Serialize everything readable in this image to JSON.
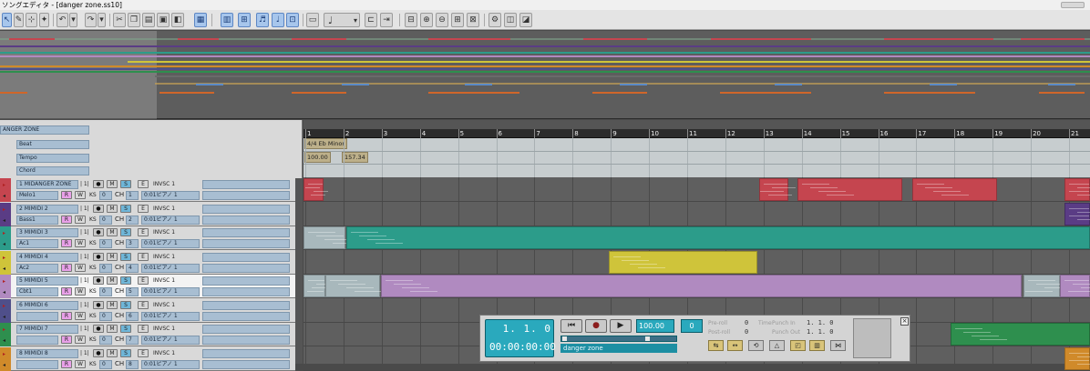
{
  "window": {
    "title": "ソングエディタ - [danger zone.ss10]"
  },
  "toolbar": {
    "note_value": "♩",
    "buttons": [
      "arrow-tool",
      "pencil-tool",
      "select-tool",
      "eraser-tool",
      "undo",
      "redo",
      "cut",
      "copy",
      "paste",
      "delete",
      "quantize",
      "view",
      "grid",
      "snap",
      "auto",
      "metronome",
      "save",
      "note-length",
      "bar",
      "loop"
    ]
  },
  "song": {
    "name": "ANGER ZONE",
    "rows": {
      "beat": "Beat",
      "tempo": "Tempo",
      "chord": "Chord"
    },
    "meter_label": "4/4 Eb Minor",
    "tempo_values": [
      "100.00",
      "157.34"
    ]
  },
  "tracks": [
    {
      "name": "1 MIDANGER ZONE",
      "sub": "Melo1",
      "ch": "1",
      "device": "INVSC 1",
      "patch": "0:01ピアノ 1",
      "color": "#c5454f",
      "label_l": "| 1|",
      "sel": false
    },
    {
      "name": "2 MIMIDI 2",
      "sub": "Bass1",
      "ch": "2",
      "device": "INVSC 1",
      "patch": "0:01ピアノ 1",
      "color": "#5a3c85",
      "label_l": "| 1|",
      "sel": false
    },
    {
      "name": "3 MIMIDI 3",
      "sub": "Ac1",
      "ch": "3",
      "device": "INVSC 1",
      "patch": "0:01ピアノ 1",
      "color": "#2c9c8a",
      "label_l": "| 1|",
      "sel": false
    },
    {
      "name": "4 MIMIDI 4",
      "sub": "Ac2",
      "ch": "4",
      "device": "INVSC 1",
      "patch": "0:01ピアノ 1",
      "color": "#cfc43a",
      "label_l": "| 1|",
      "sel": false
    },
    {
      "name": "5 MIMIDI 5",
      "sub": "Cbt1",
      "ch": "5",
      "device": "INVSC 1",
      "patch": "0:01ピアノ 1",
      "color": "#b08ac0",
      "label_l": "| 1|",
      "sel": true
    },
    {
      "name": "6 MIMIDI 6",
      "sub": "",
      "ch": "6",
      "device": "INVSC 1",
      "patch": "0:01ピアノ 1",
      "color": "#4f4f8a",
      "label_l": "| 1|",
      "sel": false
    },
    {
      "name": "7 MIMIDI 7",
      "sub": "",
      "ch": "7",
      "device": "INVSC 1",
      "patch": "0:01ピアノ 1",
      "color": "#2e8f4e",
      "label_l": "| 1|",
      "sel": false
    },
    {
      "name": "8 MIMIDI 8",
      "sub": "",
      "ch": "8",
      "device": "INVSC 1",
      "patch": "0:01ピアノ 1",
      "color": "#d08a2a",
      "label_l": "| 1|",
      "sel": false
    }
  ],
  "track_buttons": {
    "rec": "●",
    "mute": "M",
    "solo": "S",
    "read": "R",
    "write": "W",
    "ks": "KS",
    "ks_val": "0",
    "ch": "CH",
    "edit": "E"
  },
  "ruler": {
    "bars": [
      "1",
      "2",
      "3",
      "4",
      "5",
      "6",
      "7",
      "8",
      "9",
      "10",
      "11",
      "12",
      "13",
      "14",
      "15",
      "16",
      "17",
      "18",
      "19",
      "20",
      "21"
    ]
  },
  "transport": {
    "position": "1.   1.   0",
    "timecode": "00:00:00:00",
    "tempo": "100.00",
    "beat": "0",
    "song_name": "danger zone",
    "pre_roll_label": "Pre-roll",
    "post_roll_label": "Post-roll",
    "pre_roll": "0",
    "post_roll": "0",
    "punch_in_label": "Punch In",
    "punch_out_label": "Punch Out",
    "punch_in": "1.   1.   0",
    "punch_out": "1.   1.   0",
    "time_label": "Time",
    "close": "×",
    "buttons": {
      "rewind": "⏮",
      "stop": "●",
      "play": "▶"
    }
  }
}
